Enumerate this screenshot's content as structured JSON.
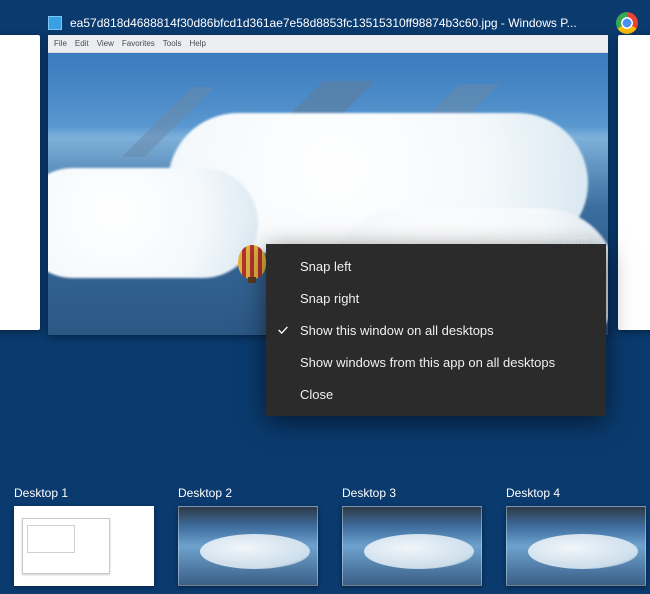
{
  "window": {
    "title": "ea57d818d4688814f30d86bfcd1d361ae7e58d8853fc13515310ff98874b3c60.jpg - Windows P..."
  },
  "menubar": {
    "items": [
      "File",
      "Edit",
      "View",
      "Favorites",
      "Tools",
      "Help"
    ]
  },
  "watermark": "Winhelponline.com",
  "context_menu": {
    "items": [
      {
        "label": "Snap left",
        "checked": false
      },
      {
        "label": "Snap right",
        "checked": false
      },
      {
        "label": "Show this window on all desktops",
        "checked": true
      },
      {
        "label": "Show windows from this app on all desktops",
        "checked": false
      },
      {
        "label": "Close",
        "checked": false
      }
    ]
  },
  "desktops": [
    {
      "label": "Desktop 1",
      "active": true
    },
    {
      "label": "Desktop 2",
      "active": false
    },
    {
      "label": "Desktop 3",
      "active": false
    },
    {
      "label": "Desktop 4",
      "active": false
    }
  ],
  "chrome_icon_name": "chrome-icon"
}
